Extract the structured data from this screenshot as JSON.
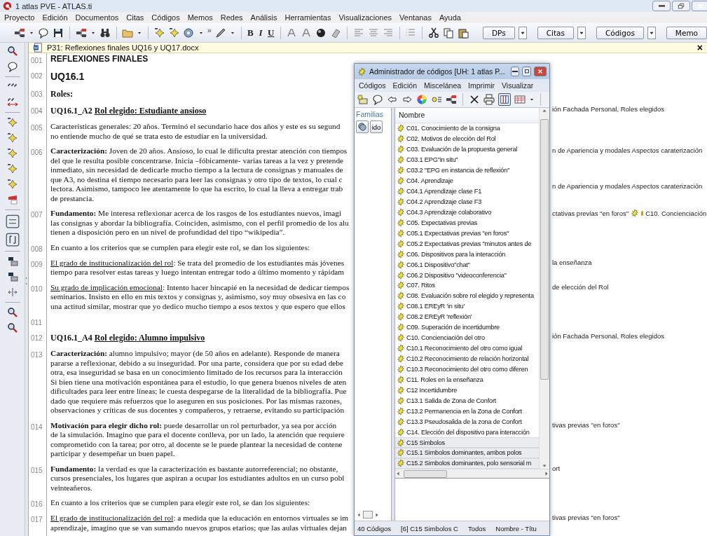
{
  "window": {
    "title": "1 atlas PVE - ATLAS.ti"
  },
  "menu": [
    "Proyecto",
    "Edición",
    "Documentos",
    "Citas",
    "Códigos",
    "Memos",
    "Redes",
    "Análisis",
    "Herramientas",
    "Visualizaciones",
    "Ventanas",
    "Ayuda"
  ],
  "toolbar": {
    "overflow": "»",
    "format_buttons": [
      "B",
      "I",
      "U"
    ],
    "dropdowns": [
      "DPs",
      "Citas",
      "Códigos",
      "Memo"
    ]
  },
  "document_tab": {
    "title": "P31: Reflexiones finales UQ16 y UQ17.docx",
    "close": "×"
  },
  "document": {
    "rows": [
      {
        "num": "001",
        "kind": "title",
        "lines": [
          "REFLEXIONES FINALES"
        ]
      },
      {
        "num": "002",
        "kind": "subtitle",
        "lines": [
          "UQ16.1"
        ]
      },
      {
        "num": "003",
        "kind": "heading",
        "lines": [
          "Roles:"
        ]
      },
      {
        "num": "004",
        "kind": "heading",
        "lines": [
          [
            {
              "text": "UQ16.1_A2  ",
              "underline": false
            },
            {
              "text": "Rol elegido: Estudiante ansioso",
              "underline": true
            }
          ]
        ],
        "margin": [
          [
            "ión Fachada Personal, Roles elegidos"
          ]
        ]
      },
      {
        "num": "005",
        "kind": "body",
        "lines": [
          "Características generales: 20 años. Terminó el secundario hace dos años y este es su segund",
          "no entiende mucho de qué se trata esto de estudiar en la universidad."
        ]
      },
      {
        "num": "006",
        "kind": "body",
        "lines": [
          "**Caracterización:** Joven de 20 años. Ansioso, lo cual le dificulta prestar atención con tiempos",
          "del que le resulta posible concentrarse. Inicia –fóbicamente- varias tareas a la vez y pretende",
          "inmediato, sin necesidad de dedicarle mucho tiempo a la lectura de consignas y manuales de",
          "que A3, no destina el tiempo necesario para leer las consignas y otro tipo de textos, lo cual c",
          "lectora. Asimismo, tampoco lee atentamente lo que ha escrito, lo cual la lleva a entregar trab",
          "de prestancia."
        ],
        "margin": [
          [
            "n de Apariencia y modales Aspectos caraterización"
          ],
          [
            "n de Apariencia y modales Aspectos caraterización"
          ]
        ]
      },
      {
        "num": "007",
        "kind": "body",
        "lines": [
          "**Fundamento:** Me interesa reflexionar acerca de los rasgos de los estudiantes nuevos, imagi",
          "las consignas y abordar la bibliografía. Coinciden, asimismo, con el perfil promedio de los alu",
          "tienen a disposición pero en un nivel de profundidad del tipo “wikipedia”."
        ],
        "margin": [
          [
            "ctativas previas  \"en foros\"",
            "C10. Concienciación"
          ]
        ]
      },
      {
        "num": "008",
        "kind": "body",
        "lines": [
          "En cuanto a los criterios que se cumplen para elegir este rol, se dan los siguientes:"
        ]
      },
      {
        "num": "009",
        "kind": "body",
        "lines": [
          [
            {
              "text": "El grado de institucionalización del rol",
              "underline": true
            },
            {
              "text": ":  Se trata del promedio de los estudiantes más jóvenes",
              "underline": false
            }
          ],
          "tiempo para resolver estas tareas y luego intentan entregar todo a último momento y rápidam"
        ],
        "margin": [
          [
            "la enseñanza"
          ]
        ]
      },
      {
        "num": "010",
        "kind": "body",
        "lines": [
          [
            {
              "text": "Su grado de implicación emocional",
              "underline": true
            },
            {
              "text": ": Intento hacer hincapié en la necesidad de dedicar tiempos",
              "underline": false
            }
          ],
          "seminarios. Insisto en ello en mis textos y consignas y, asimismo, soy muy obsesiva en las co",
          "una actitud similar, mostrar que yo dedico mucho tiempo a esos textos y que espero que ellos"
        ],
        "margin": [
          [
            "de elección del Rol"
          ]
        ]
      },
      {
        "num": "011",
        "kind": "body"
      },
      {
        "num": "012",
        "kind": "heading",
        "lines": [
          [
            {
              "text": "UQ16.1_A4  ",
              "underline": false
            },
            {
              "text": "Rol elegido: Alumno impulsivo",
              "underline": true
            }
          ]
        ],
        "margin": [
          [
            "ión Fachada Personal, Roles elegidos"
          ]
        ]
      },
      {
        "num": "013",
        "kind": "body",
        "lines": [
          "**Caracterización:** alumno impulsivo; mayor (de 50 años en adelante). Responde de manera",
          "pararse a reflexionar, debido a su inseguridad. Por una parte, considera que por su edad debe",
          "otra, esa inseguridad se basa en un conocimiento limitado de los recursos para la interacción",
          "Si bien tiene una motivación espontánea para el estudio, lo que genera buenos niveles de aten",
          "dificultades para leer entre líneas; le cuesta despegarse de la literalidad de la bibliografía. Pue",
          "dado que requiere más refuerzos que lo aseguren en sus posiciones. Por las mismas razones,",
          "observaciones y críticas de sus docentes y compañeros, y retraerse, evitando su participación"
        ]
      },
      {
        "num": "014",
        "kind": "body",
        "lines": [
          "**Motivación para elegir dicho rol:** puede desarrollar un rol perturbador, ya sea por acción",
          "de la simulación. Imagino que para el docente conlleva, por un lado, la atención que requiere",
          "comprometido con la tarea; por otro, al docente se le puede plantear la necesidad de contene",
          "participar y desempeñar un buen papel."
        ],
        "margin": [
          [
            "tivas previas  \"en foros\""
          ]
        ]
      },
      {
        "num": "015",
        "kind": "body",
        "lines": [
          "**Fundamento:** la verdad es que la caracterización es bastante autorreferencial; no obstante,",
          "cursos presenciales, los lugares que aspiran a ocupar los estudiantes adultos en un curso pobl",
          "veinteañeros."
        ],
        "margin": [
          [
            "ort"
          ]
        ]
      },
      {
        "num": "016",
        "kind": "body",
        "lines": [
          "En cuanto a los criterios que se cumplen para elegir este rol, se dan los siguientes:"
        ]
      },
      {
        "num": "017",
        "kind": "body",
        "lines": [
          [
            {
              "text": "El grado de institucionalización del rol",
              "underline": true
            },
            {
              "text": ": a medida que la educación en entornos virtuales se im",
              "underline": false
            }
          ],
          "aprendizaje, imagino que se van sumando nuevos grupos etarios; que las aulas virtuales dejan"
        ],
        "margin": [
          [
            "tivas previas  \"en foros\""
          ]
        ]
      }
    ]
  },
  "code_manager": {
    "title": "Administrador de códigos [UH: 1 atlas P...",
    "menu": [
      "Códigos",
      "Edición",
      "Miscelánea",
      "Imprimir",
      "Visualizar"
    ],
    "families_label": "Familias",
    "families_button": "ido",
    "list_header": "Nombre",
    "codes": [
      {
        "label": "C01. Conocimiento de la consigna",
        "selected": false
      },
      {
        "label": "C02. Motivos de elección del Rol",
        "selected": false
      },
      {
        "label": "C03. Evaluación de la propuesta general",
        "selected": false
      },
      {
        "label": "C03.1  EPG\"in situ\"",
        "selected": false
      },
      {
        "label": "C03.2 \"EPG en instancia de reflexión\"",
        "selected": false
      },
      {
        "label": "C04. Aprendizaje",
        "selected": false
      },
      {
        "label": "C04.1 Aprendizaje clase F1",
        "selected": false
      },
      {
        "label": "C04.2 Aprendizaje clase F3",
        "selected": false
      },
      {
        "label": "C04.3 Aprendizaje colaborativo",
        "selected": false
      },
      {
        "label": "C05. Expectativas previas",
        "selected": false
      },
      {
        "label": "C05.1 Expectativas previas  \"en foros\"",
        "selected": false
      },
      {
        "label": "C05.2 Expectativas previas \"minutos antes de",
        "selected": false
      },
      {
        "label": "C06. Dispositivos para la interacción",
        "selected": false
      },
      {
        "label": "C06.1 Dispositivo\"chat\"",
        "selected": false
      },
      {
        "label": "C06.2 Dispositivo \"videoconferencia\"",
        "selected": false
      },
      {
        "label": "C07. Ritos",
        "selected": false
      },
      {
        "label": "C08. Evaluación sobre rol elegido y representa",
        "selected": false
      },
      {
        "label": "C08.1 EREyR 'in situ'",
        "selected": false
      },
      {
        "label": "C08.2 EREyR 'reflexión'",
        "selected": false
      },
      {
        "label": "C09. Superación de incertidumbre",
        "selected": false
      },
      {
        "label": "C10. Concienciación del otro",
        "selected": false
      },
      {
        "label": "C10.1 Reconocimiento del otro como igual",
        "selected": false
      },
      {
        "label": "C10.2 Reconocimiento de relación horizontal",
        "selected": false
      },
      {
        "label": "C10.3 Reconocimiento del otro como diferen",
        "selected": false
      },
      {
        "label": "C11. Roles en la enseñanza",
        "selected": false
      },
      {
        "label": "C12 Incertidumbre",
        "selected": false
      },
      {
        "label": "C13.1 Salida de Zona de Confort",
        "selected": false
      },
      {
        "label": "C13.2 Permanencia en la Zona de Confort",
        "selected": false
      },
      {
        "label": "C13.3 Pseudosalida de la zona de Confort",
        "selected": false
      },
      {
        "label": "C14. Elección del dispositivo para interacción",
        "selected": false
      },
      {
        "label": "C15 Simbolos",
        "selected": true
      },
      {
        "label": "C15.1 Simbolos dominantes, ambos polos",
        "selected": true
      },
      {
        "label": "C15.2 Simbolos dominantes, polo sensorial m",
        "selected": true
      }
    ],
    "status": [
      "40 Códigos",
      "[6] C15 Simbolos  C",
      "Todos",
      "Nombre - Títu"
    ]
  }
}
